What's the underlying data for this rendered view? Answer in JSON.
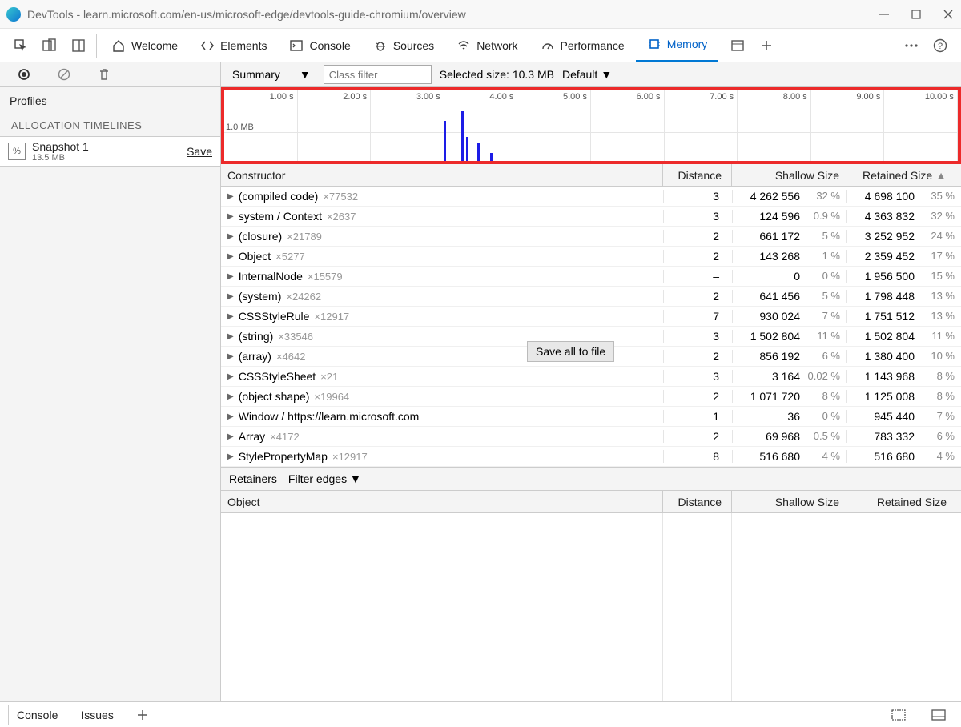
{
  "window": {
    "title": "DevTools - learn.microsoft.com/en-us/microsoft-edge/devtools-guide-chromium/overview"
  },
  "tabs": {
    "welcome": "Welcome",
    "elements": "Elements",
    "console": "Console",
    "sources": "Sources",
    "network": "Network",
    "performance": "Performance",
    "memory": "Memory"
  },
  "sidebar": {
    "profiles": "Profiles",
    "allocation": "ALLOCATION TIMELINES",
    "snapshot_name": "Snapshot 1",
    "snapshot_size": "13.5 MB",
    "save": "Save"
  },
  "filter": {
    "summary": "Summary",
    "class_placeholder": "Class filter",
    "selected": "Selected size: 10.3 MB",
    "default": "Default"
  },
  "timeline": {
    "ticks": [
      "1.00 s",
      "2.00 s",
      "3.00 s",
      "4.00 s",
      "5.00 s",
      "6.00 s",
      "7.00 s",
      "8.00 s",
      "9.00 s",
      "10.00 s"
    ],
    "mb_label": "1.0 MB"
  },
  "headers": {
    "constructor": "Constructor",
    "distance": "Distance",
    "shallow": "Shallow Size",
    "retained": "Retained Size"
  },
  "rows": [
    {
      "name": "(compiled code)",
      "count": "×77532",
      "dist": "3",
      "sh": "4 262 556",
      "shp": "32 %",
      "re": "4 698 100",
      "rep": "35 %"
    },
    {
      "name": "system / Context",
      "count": "×2637",
      "dist": "3",
      "sh": "124 596",
      "shp": "0.9 %",
      "re": "4 363 832",
      "rep": "32 %"
    },
    {
      "name": "(closure)",
      "count": "×21789",
      "dist": "2",
      "sh": "661 172",
      "shp": "5 %",
      "re": "3 252 952",
      "rep": "24 %"
    },
    {
      "name": "Object",
      "count": "×5277",
      "dist": "2",
      "sh": "143 268",
      "shp": "1 %",
      "re": "2 359 452",
      "rep": "17 %"
    },
    {
      "name": "InternalNode",
      "count": "×15579",
      "dist": "–",
      "sh": "0",
      "shp": "0 %",
      "re": "1 956 500",
      "rep": "15 %"
    },
    {
      "name": "(system)",
      "count": "×24262",
      "dist": "2",
      "sh": "641 456",
      "shp": "5 %",
      "re": "1 798 448",
      "rep": "13 %"
    },
    {
      "name": "CSSStyleRule",
      "count": "×12917",
      "dist": "7",
      "sh": "930 024",
      "shp": "7 %",
      "re": "1 751 512",
      "rep": "13 %"
    },
    {
      "name": "(string)",
      "count": "×33546",
      "dist": "3",
      "sh": "1 502 804",
      "shp": "11 %",
      "re": "1 502 804",
      "rep": "11 %"
    },
    {
      "name": "(array)",
      "count": "×4642",
      "dist": "2",
      "sh": "856 192",
      "shp": "6 %",
      "re": "1 380 400",
      "rep": "10 %"
    },
    {
      "name": "CSSStyleSheet",
      "count": "×21",
      "dist": "3",
      "sh": "3 164",
      "shp": "0.02 %",
      "re": "1 143 968",
      "rep": "8 %"
    },
    {
      "name": "(object shape)",
      "count": "×19964",
      "dist": "2",
      "sh": "1 071 720",
      "shp": "8 %",
      "re": "1 125 008",
      "rep": "8 %"
    },
    {
      "name": "Window / https://learn.microsoft.com",
      "count": "",
      "dist": "1",
      "sh": "36",
      "shp": "0 %",
      "re": "945 440",
      "rep": "7 %"
    },
    {
      "name": "Array",
      "count": "×4172",
      "dist": "2",
      "sh": "69 968",
      "shp": "0.5 %",
      "re": "783 332",
      "rep": "6 %"
    },
    {
      "name": "StylePropertyMap",
      "count": "×12917",
      "dist": "8",
      "sh": "516 680",
      "shp": "4 %",
      "re": "516 680",
      "rep": "4 %"
    }
  ],
  "tooltip": "Save all to file",
  "retainers": {
    "label": "Retainers",
    "filter": "Filter edges",
    "object": "Object"
  },
  "bottom": {
    "console": "Console",
    "issues": "Issues"
  }
}
